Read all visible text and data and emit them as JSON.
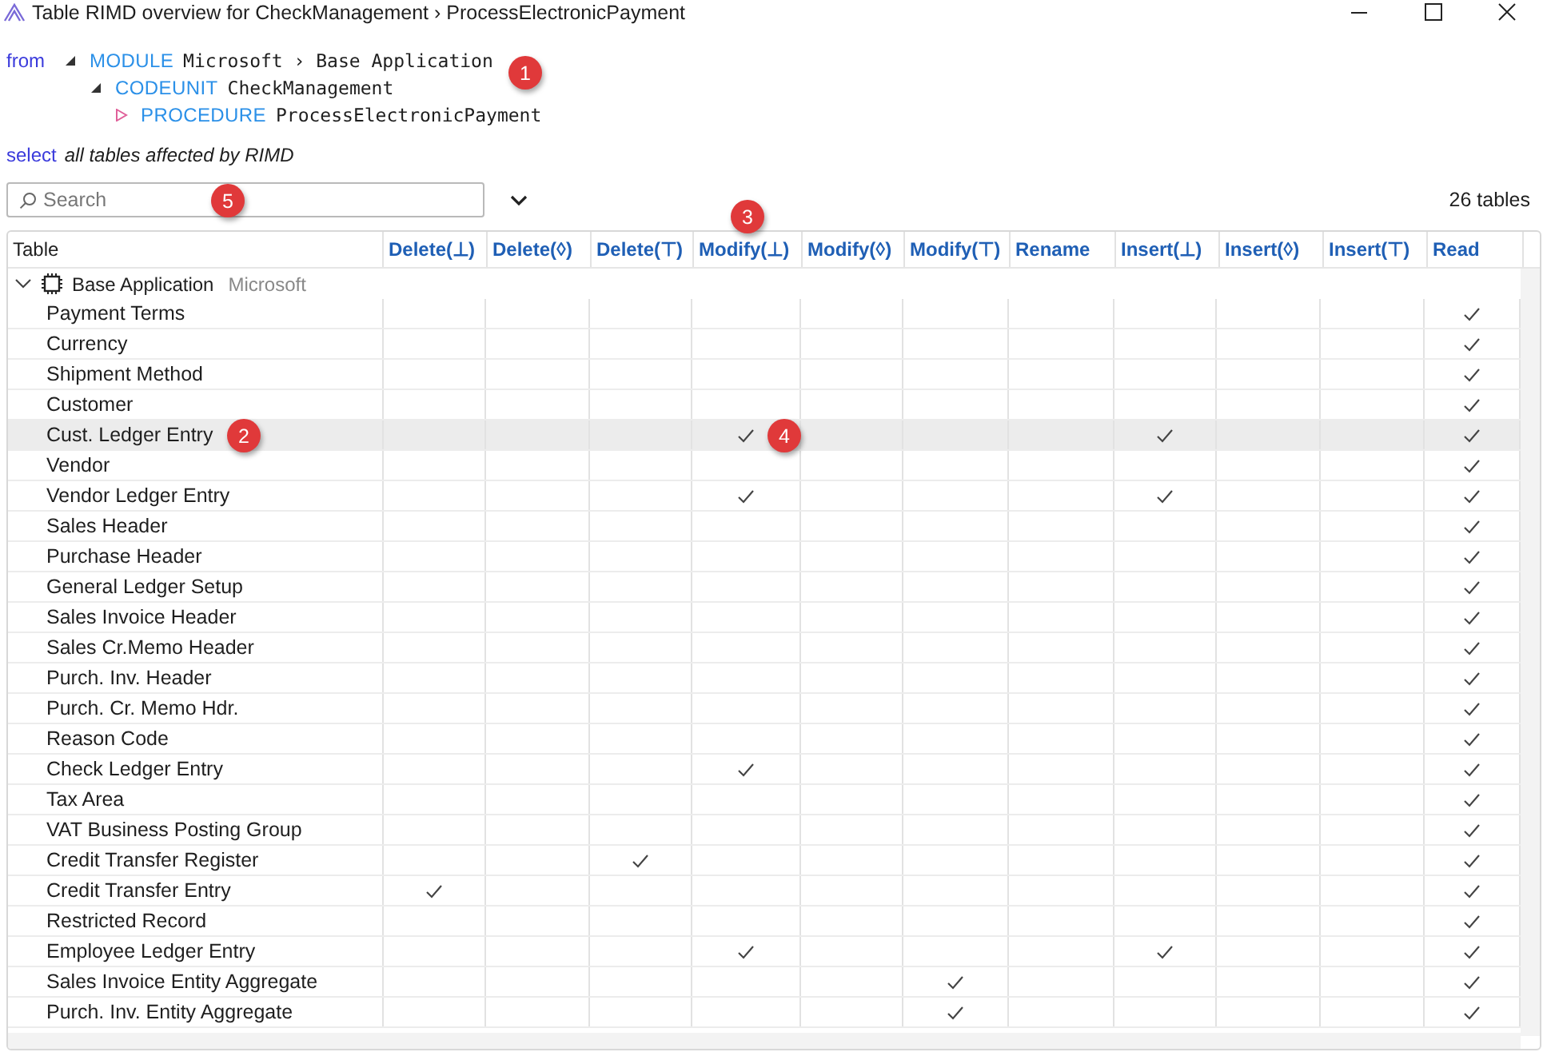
{
  "window": {
    "title": "Table RIMD overview for CheckManagement › ProcessElectronicPayment"
  },
  "query": {
    "from_keyword": "from",
    "path": [
      {
        "keyword": "MODULE",
        "name": "Microsoft › Base Application",
        "expanded": true
      },
      {
        "keyword": "CODEUNIT",
        "name": "CheckManagement",
        "expanded": true
      },
      {
        "keyword": "PROCEDURE",
        "name": "ProcessElectronicPayment",
        "expanded": false
      }
    ],
    "select_keyword": "select",
    "select_text": "all tables affected by RIMD"
  },
  "search": {
    "placeholder": "Search"
  },
  "count": "26 tables",
  "table": {
    "columns": [
      "Table",
      "Delete(⊥)",
      "Delete(◊)",
      "Delete(⊤)",
      "Modify(⊥)",
      "Modify(◊)",
      "Modify(⊤)",
      "Rename",
      "Insert(⊥)",
      "Insert(◊)",
      "Insert(⊤)",
      "Read"
    ],
    "group": {
      "name": "Base Application",
      "publisher": "Microsoft",
      "expanded": true
    },
    "rows": [
      {
        "name": "Payment Terms",
        "selected": false,
        "checks": [
          false,
          false,
          false,
          false,
          false,
          false,
          false,
          false,
          false,
          false,
          true
        ]
      },
      {
        "name": "Currency",
        "selected": false,
        "checks": [
          false,
          false,
          false,
          false,
          false,
          false,
          false,
          false,
          false,
          false,
          true
        ]
      },
      {
        "name": "Shipment Method",
        "selected": false,
        "checks": [
          false,
          false,
          false,
          false,
          false,
          false,
          false,
          false,
          false,
          false,
          true
        ]
      },
      {
        "name": "Customer",
        "selected": false,
        "checks": [
          false,
          false,
          false,
          false,
          false,
          false,
          false,
          false,
          false,
          false,
          true
        ]
      },
      {
        "name": "Cust. Ledger Entry",
        "selected": true,
        "checks": [
          false,
          false,
          false,
          true,
          false,
          false,
          false,
          true,
          false,
          false,
          true
        ]
      },
      {
        "name": "Vendor",
        "selected": false,
        "checks": [
          false,
          false,
          false,
          false,
          false,
          false,
          false,
          false,
          false,
          false,
          true
        ]
      },
      {
        "name": "Vendor Ledger Entry",
        "selected": false,
        "checks": [
          false,
          false,
          false,
          true,
          false,
          false,
          false,
          true,
          false,
          false,
          true
        ]
      },
      {
        "name": "Sales Header",
        "selected": false,
        "checks": [
          false,
          false,
          false,
          false,
          false,
          false,
          false,
          false,
          false,
          false,
          true
        ]
      },
      {
        "name": "Purchase Header",
        "selected": false,
        "checks": [
          false,
          false,
          false,
          false,
          false,
          false,
          false,
          false,
          false,
          false,
          true
        ]
      },
      {
        "name": "General Ledger Setup",
        "selected": false,
        "checks": [
          false,
          false,
          false,
          false,
          false,
          false,
          false,
          false,
          false,
          false,
          true
        ]
      },
      {
        "name": "Sales Invoice Header",
        "selected": false,
        "checks": [
          false,
          false,
          false,
          false,
          false,
          false,
          false,
          false,
          false,
          false,
          true
        ]
      },
      {
        "name": "Sales Cr.Memo Header",
        "selected": false,
        "checks": [
          false,
          false,
          false,
          false,
          false,
          false,
          false,
          false,
          false,
          false,
          true
        ]
      },
      {
        "name": "Purch. Inv. Header",
        "selected": false,
        "checks": [
          false,
          false,
          false,
          false,
          false,
          false,
          false,
          false,
          false,
          false,
          true
        ]
      },
      {
        "name": "Purch. Cr. Memo Hdr.",
        "selected": false,
        "checks": [
          false,
          false,
          false,
          false,
          false,
          false,
          false,
          false,
          false,
          false,
          true
        ]
      },
      {
        "name": "Reason Code",
        "selected": false,
        "checks": [
          false,
          false,
          false,
          false,
          false,
          false,
          false,
          false,
          false,
          false,
          true
        ]
      },
      {
        "name": "Check Ledger Entry",
        "selected": false,
        "checks": [
          false,
          false,
          false,
          true,
          false,
          false,
          false,
          false,
          false,
          false,
          true
        ]
      },
      {
        "name": "Tax Area",
        "selected": false,
        "checks": [
          false,
          false,
          false,
          false,
          false,
          false,
          false,
          false,
          false,
          false,
          true
        ]
      },
      {
        "name": "VAT Business Posting Group",
        "selected": false,
        "checks": [
          false,
          false,
          false,
          false,
          false,
          false,
          false,
          false,
          false,
          false,
          true
        ]
      },
      {
        "name": "Credit Transfer Register",
        "selected": false,
        "checks": [
          false,
          false,
          true,
          false,
          false,
          false,
          false,
          false,
          false,
          false,
          true
        ]
      },
      {
        "name": "Credit Transfer Entry",
        "selected": false,
        "checks": [
          true,
          false,
          false,
          false,
          false,
          false,
          false,
          false,
          false,
          false,
          true
        ]
      },
      {
        "name": "Restricted Record",
        "selected": false,
        "checks": [
          false,
          false,
          false,
          false,
          false,
          false,
          false,
          false,
          false,
          false,
          true
        ]
      },
      {
        "name": "Employee Ledger Entry",
        "selected": false,
        "checks": [
          false,
          false,
          false,
          true,
          false,
          false,
          false,
          true,
          false,
          false,
          true
        ]
      },
      {
        "name": "Sales Invoice Entity Aggregate",
        "selected": false,
        "checks": [
          false,
          false,
          false,
          false,
          false,
          true,
          false,
          false,
          false,
          false,
          true
        ]
      },
      {
        "name": "Purch. Inv. Entity Aggregate",
        "selected": false,
        "checks": [
          false,
          false,
          false,
          false,
          false,
          true,
          false,
          false,
          false,
          false,
          true
        ]
      }
    ]
  },
  "callouts": [
    {
      "label": "1"
    },
    {
      "label": "2"
    },
    {
      "label": "3"
    },
    {
      "label": "4"
    },
    {
      "label": "5"
    }
  ]
}
